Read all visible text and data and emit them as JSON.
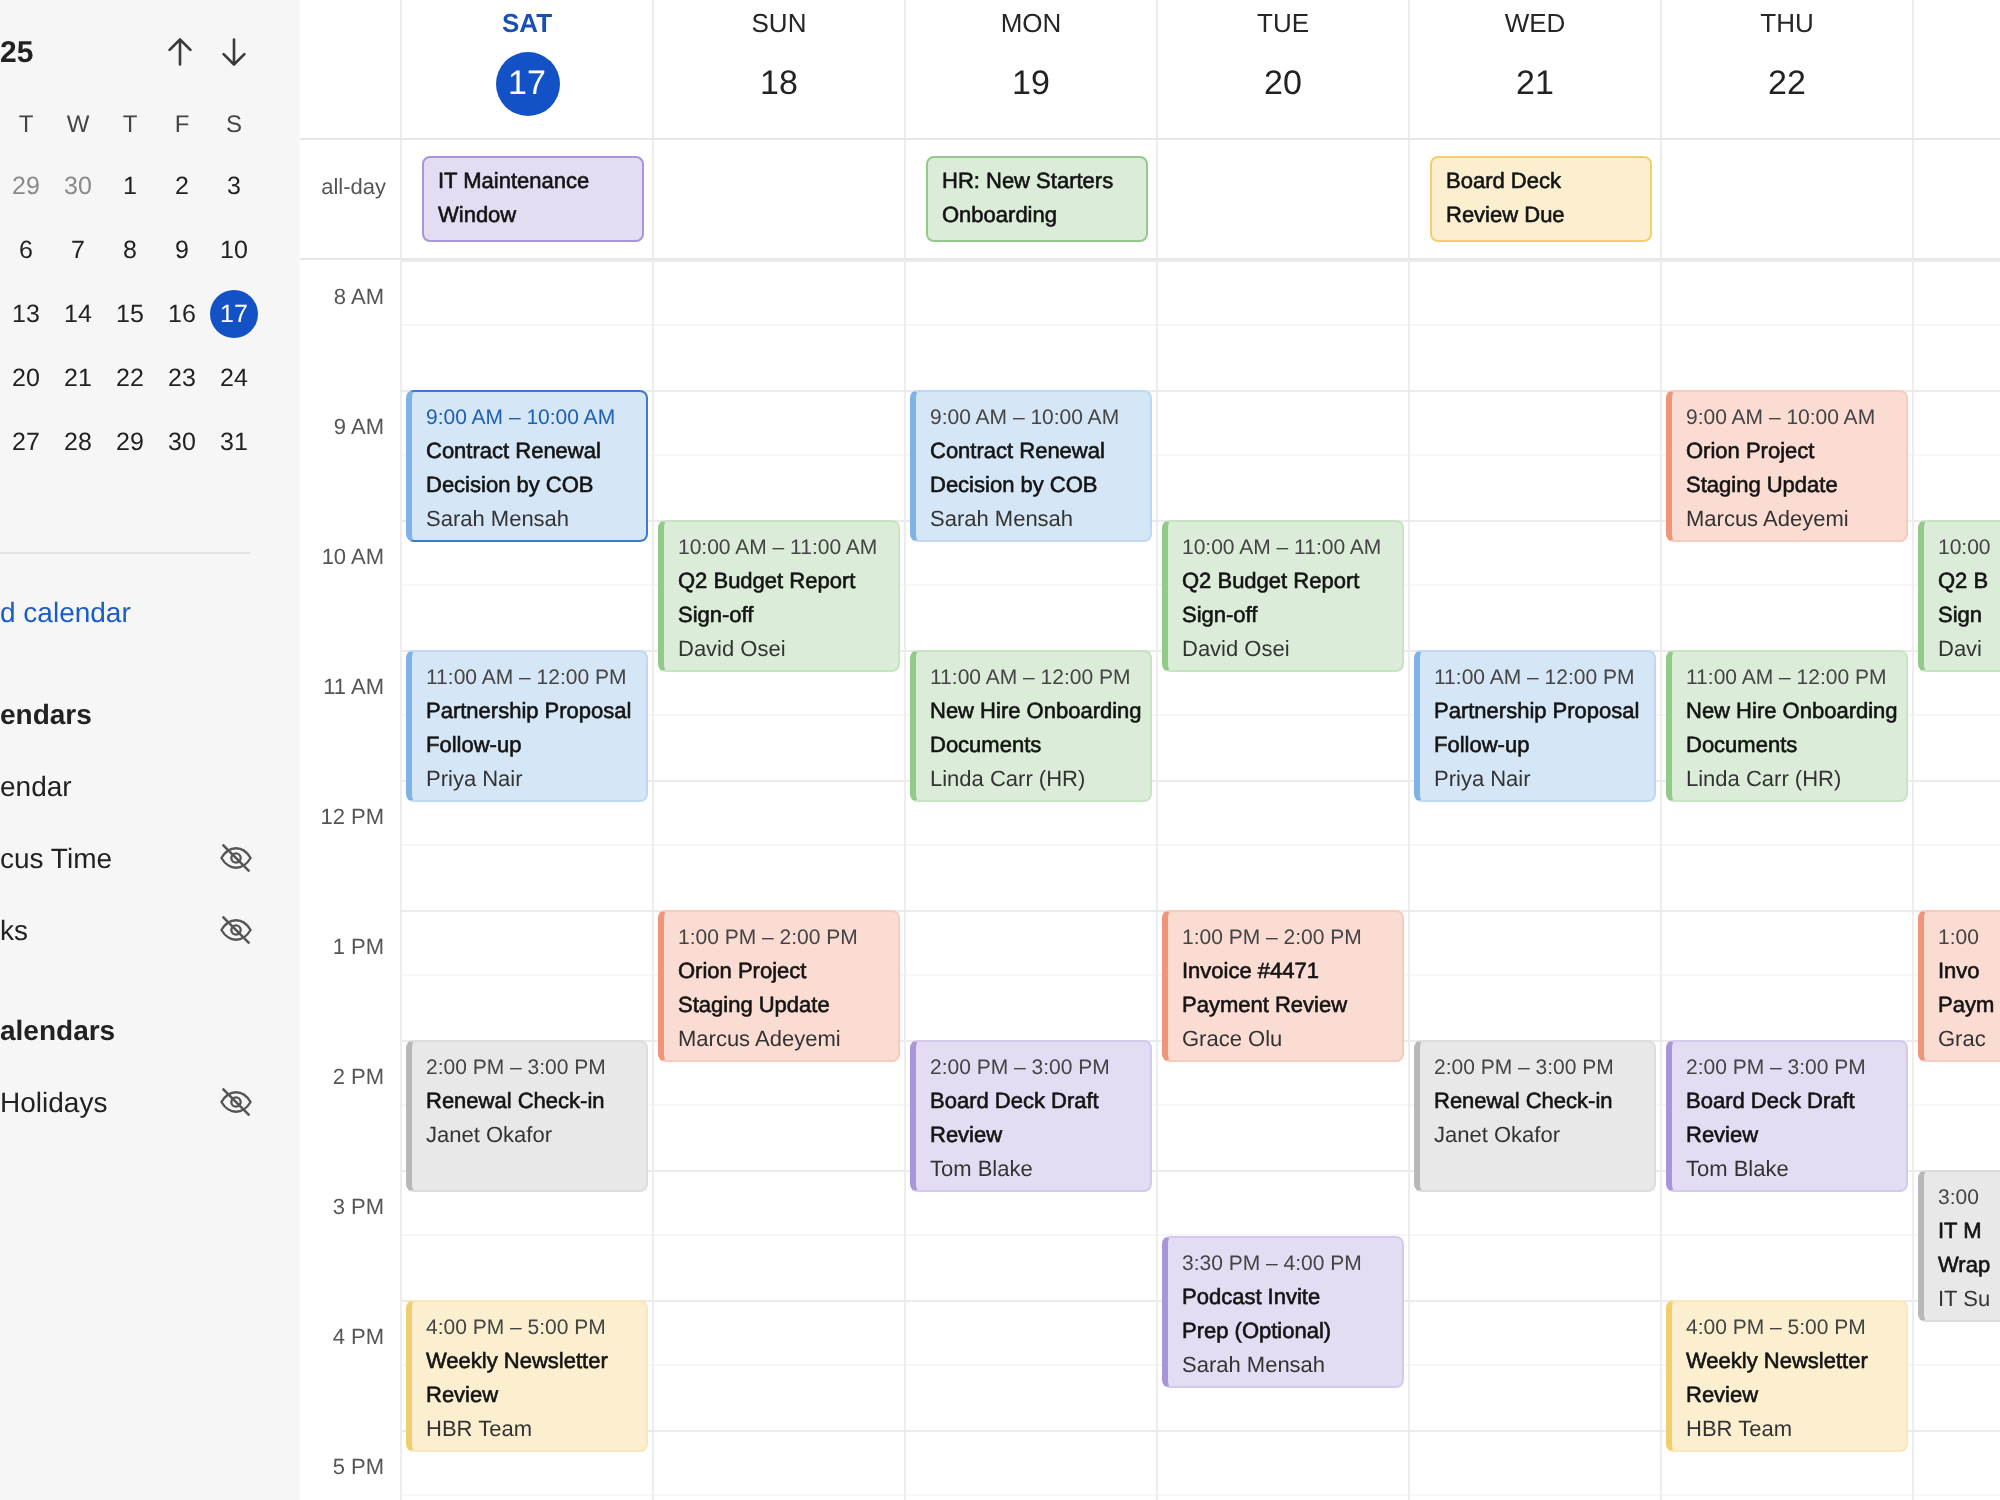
{
  "sidebar": {
    "month_label": "25",
    "weekdays": [
      "T",
      "W",
      "T",
      "F",
      "S"
    ],
    "weeks": [
      [
        {
          "day": "29",
          "in_month": false,
          "selected": false
        },
        {
          "day": "30",
          "in_month": false,
          "selected": false
        },
        {
          "day": "1",
          "in_month": true,
          "selected": false
        },
        {
          "day": "2",
          "in_month": true,
          "selected": false
        },
        {
          "day": "3",
          "in_month": true,
          "selected": false
        }
      ],
      [
        {
          "day": "6",
          "in_month": true,
          "selected": false
        },
        {
          "day": "7",
          "in_month": true,
          "selected": false
        },
        {
          "day": "8",
          "in_month": true,
          "selected": false
        },
        {
          "day": "9",
          "in_month": true,
          "selected": false
        },
        {
          "day": "10",
          "in_month": true,
          "selected": false
        }
      ],
      [
        {
          "day": "13",
          "in_month": true,
          "selected": false
        },
        {
          "day": "14",
          "in_month": true,
          "selected": false
        },
        {
          "day": "15",
          "in_month": true,
          "selected": false
        },
        {
          "day": "16",
          "in_month": true,
          "selected": false
        },
        {
          "day": "17",
          "in_month": true,
          "selected": true
        }
      ],
      [
        {
          "day": "20",
          "in_month": true,
          "selected": false
        },
        {
          "day": "21",
          "in_month": true,
          "selected": false
        },
        {
          "day": "22",
          "in_month": true,
          "selected": false
        },
        {
          "day": "23",
          "in_month": true,
          "selected": false
        },
        {
          "day": "24",
          "in_month": true,
          "selected": false
        }
      ],
      [
        {
          "day": "27",
          "in_month": true,
          "selected": false
        },
        {
          "day": "28",
          "in_month": true,
          "selected": false
        },
        {
          "day": "29",
          "in_month": true,
          "selected": false
        },
        {
          "day": "30",
          "in_month": true,
          "selected": false
        },
        {
          "day": "31",
          "in_month": true,
          "selected": false
        }
      ]
    ],
    "link": "d calendar",
    "sections": [
      {
        "heading": "endars",
        "items": [
          {
            "label": "endar",
            "hidden": false
          },
          {
            "label": "cus Time",
            "hidden": true
          },
          {
            "label": "ks",
            "hidden": true
          }
        ]
      },
      {
        "heading": "alendars",
        "items": [
          {
            "label": "Holidays",
            "hidden": true
          }
        ]
      }
    ]
  },
  "week": {
    "all_day_label": "all-day",
    "time_labels": [
      "8 AM",
      "9 AM",
      "10 AM",
      "11 AM",
      "12 PM",
      "1 PM",
      "2 PM",
      "3 PM",
      "4 PM",
      "5 PM"
    ],
    "days": [
      {
        "name": "SAT",
        "date": "17",
        "selected": true,
        "all_day": [
          {
            "title": "IT Maintenance\nWindow",
            "color": "#a995d9"
          }
        ],
        "events": [
          {
            "time": "9:00 AM – 10:00 AM",
            "title": "Contract Renewal\nDecision by COB",
            "person": "Sarah Mensah",
            "color": "#7fb2e5",
            "selected": true
          },
          {
            "time": "11:00 AM – 12:00 PM",
            "title": "Partnership Proposal\nFollow-up",
            "person": "Priya Nair",
            "color": "#7fb2e5",
            "selected": false
          },
          {
            "time": "2:00 PM – 3:00 PM",
            "title": "Renewal Check-in",
            "person": "Janet Okafor",
            "color": "#b8b8b8",
            "selected": false
          },
          {
            "time": "4:00 PM – 5:00 PM",
            "title": "Weekly Newsletter\nReview",
            "person": "HBR Team",
            "color": "#f2cf6e",
            "selected": false
          }
        ]
      },
      {
        "name": "SUN",
        "date": "18",
        "selected": false,
        "events": [
          {
            "time": "10:00 AM – 11:00 AM",
            "title": "Q2 Budget Report\nSign-off",
            "person": "David Osei",
            "color": "#93c98a",
            "selected": false
          },
          {
            "time": "1:00 PM – 2:00 PM",
            "title": "Orion Project\nStaging Update",
            "person": "Marcus Adeyemi",
            "color": "#f0957a",
            "selected": false
          }
        ]
      },
      {
        "name": "MON",
        "date": "19",
        "selected": false,
        "all_day": [
          {
            "title": "HR: New Starters\nOnboarding",
            "color": "#93c98a"
          }
        ],
        "events": [
          {
            "time": "9:00 AM – 10:00 AM",
            "title": "Contract Renewal\nDecision by COB",
            "person": "Sarah Mensah",
            "color": "#7fb2e5",
            "selected": false
          },
          {
            "time": "11:00 AM – 12:00 PM",
            "title": "New Hire Onboarding\nDocuments",
            "person": "Linda Carr (HR)",
            "color": "#93c98a",
            "selected": false
          },
          {
            "time": "2:00 PM – 3:00 PM",
            "title": "Board Deck Draft\nReview",
            "person": "Tom Blake",
            "color": "#a995d9",
            "selected": false
          }
        ]
      },
      {
        "name": "TUE",
        "date": "20",
        "selected": false,
        "events": [
          {
            "time": "10:00 AM – 11:00 AM",
            "title": "Q2 Budget Report\nSign-off",
            "person": "David Osei",
            "color": "#93c98a",
            "selected": false
          },
          {
            "time": "1:00 PM – 2:00 PM",
            "title": "Invoice #4471\nPayment Review",
            "person": "Grace Olu",
            "color": "#f0957a",
            "selected": false
          },
          {
            "time": "3:30 PM – 4:00 PM",
            "title": "Podcast Invite\nPrep (Optional)",
            "person": "Sarah Mensah",
            "color": "#a995d9",
            "selected": false
          }
        ]
      },
      {
        "name": "WED",
        "date": "21",
        "selected": false,
        "all_day": [
          {
            "title": "Board Deck\nReview Due",
            "color": "#f2cf6e"
          }
        ],
        "events": [
          {
            "time": "11:00 AM – 12:00 PM",
            "title": "Partnership Proposal\nFollow-up",
            "person": "Priya Nair",
            "color": "#7fb2e5",
            "selected": false
          },
          {
            "time": "2:00 PM – 3:00 PM",
            "title": "Renewal Check-in",
            "person": "Janet Okafor",
            "color": "#b8b8b8",
            "selected": false
          }
        ]
      },
      {
        "name": "THU",
        "date": "22",
        "selected": false,
        "events": [
          {
            "time": "9:00 AM – 10:00 AM",
            "title": "Orion Project\nStaging Update",
            "person": "Marcus Adeyemi",
            "color": "#f0957a",
            "selected": false
          },
          {
            "time": "11:00 AM – 12:00 PM",
            "title": "New Hire Onboarding\nDocuments",
            "person": "Linda Carr (HR)",
            "color": "#93c98a",
            "selected": false
          },
          {
            "time": "2:00 PM – 3:00 PM",
            "title": "Board Deck Draft\nReview",
            "person": "Tom Blake",
            "color": "#a995d9",
            "selected": false
          },
          {
            "time": "4:00 PM – 5:00 PM",
            "title": "Weekly Newsletter\nReview",
            "person": "HBR Team",
            "color": "#f2cf6e",
            "selected": false
          }
        ]
      }
    ],
    "cut_column": {
      "events": [
        {
          "time": "10:00",
          "title": "Q2 B\nSign",
          "person": "Davi",
          "color": "#93c98a",
          "selected": false
        },
        {
          "time": "1:00",
          "title": "Invo\nPaym",
          "person": "Grac",
          "color": "#f0957a",
          "selected": false
        },
        {
          "time": "3:00",
          "title": "IT M\nWrap",
          "person": "IT Su",
          "color": "#b8b8b8",
          "selected": false
        }
      ]
    }
  }
}
